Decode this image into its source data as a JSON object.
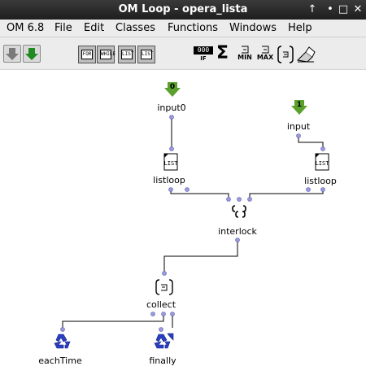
{
  "window": {
    "title": "OM Loop - opera_lista",
    "buttons": [
      "↑",
      "•",
      "□",
      "✕"
    ]
  },
  "menu": [
    "OM 6.8",
    "File",
    "Edit",
    "Classes",
    "Functions",
    "Windows",
    "Help"
  ],
  "toolbar": {
    "list_buttons": [
      "FOR",
      "WHILE",
      "LIST",
      "LIST"
    ],
    "count_label": "000",
    "count_sub": "IF",
    "min_label": "MIN",
    "max_label": "MAX"
  },
  "patch": {
    "input0": {
      "label": "input0",
      "index": "0"
    },
    "input": {
      "label": "input",
      "index": "1"
    },
    "listloop_left": {
      "label": "listloop",
      "icon_text": "LIST"
    },
    "listloop_right": {
      "label": "listloop",
      "icon_text": "LIST"
    },
    "interlock": {
      "label": "interlock"
    },
    "collect": {
      "label": "collect"
    },
    "eachtime": {
      "label": "eachTime"
    },
    "finally": {
      "label": "finally"
    }
  },
  "colors": {
    "green_arrow": "#5aa02c",
    "port": "#9b9bdc",
    "recycle_blue": "#2b3fc4"
  }
}
